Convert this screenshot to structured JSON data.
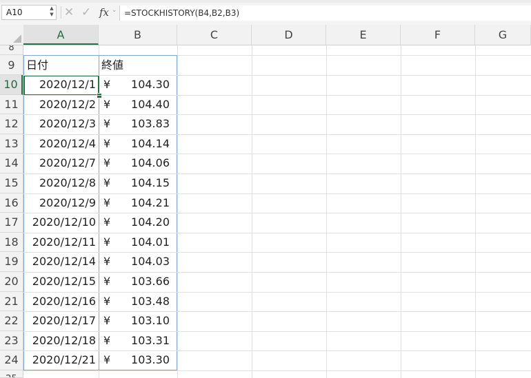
{
  "formula_bar": {
    "name_box": "A10",
    "cancel_icon": "✕",
    "enter_icon": "✓",
    "fx_label": "fx",
    "formula": "=STOCKHISTORY(B4,B2,B3)"
  },
  "columns": [
    "A",
    "B",
    "C",
    "D",
    "E",
    "F",
    "G"
  ],
  "partial_row_top": "8",
  "partial_row_bottom": "25",
  "table": {
    "header_row": "9",
    "header_date": "日付",
    "header_close": "終値",
    "rows": [
      {
        "row": "10",
        "date": "2020/12/1",
        "currency": "¥",
        "value": "104.30"
      },
      {
        "row": "11",
        "date": "2020/12/2",
        "currency": "¥",
        "value": "104.40"
      },
      {
        "row": "12",
        "date": "2020/12/3",
        "currency": "¥",
        "value": "103.83"
      },
      {
        "row": "13",
        "date": "2020/12/4",
        "currency": "¥",
        "value": "104.14"
      },
      {
        "row": "14",
        "date": "2020/12/7",
        "currency": "¥",
        "value": "104.06"
      },
      {
        "row": "15",
        "date": "2020/12/8",
        "currency": "¥",
        "value": "104.15"
      },
      {
        "row": "16",
        "date": "2020/12/9",
        "currency": "¥",
        "value": "104.21"
      },
      {
        "row": "17",
        "date": "2020/12/10",
        "currency": "¥",
        "value": "104.20"
      },
      {
        "row": "18",
        "date": "2020/12/11",
        "currency": "¥",
        "value": "104.01"
      },
      {
        "row": "19",
        "date": "2020/12/14",
        "currency": "¥",
        "value": "104.03"
      },
      {
        "row": "20",
        "date": "2020/12/15",
        "currency": "¥",
        "value": "103.66"
      },
      {
        "row": "21",
        "date": "2020/12/16",
        "currency": "¥",
        "value": "103.48"
      },
      {
        "row": "22",
        "date": "2020/12/17",
        "currency": "¥",
        "value": "103.10"
      },
      {
        "row": "23",
        "date": "2020/12/18",
        "currency": "¥",
        "value": "103.31"
      },
      {
        "row": "24",
        "date": "2020/12/21",
        "currency": "¥",
        "value": "103.30"
      }
    ]
  },
  "colors": {
    "selection_green": "#217346",
    "table_border": "#7fa7d8"
  }
}
